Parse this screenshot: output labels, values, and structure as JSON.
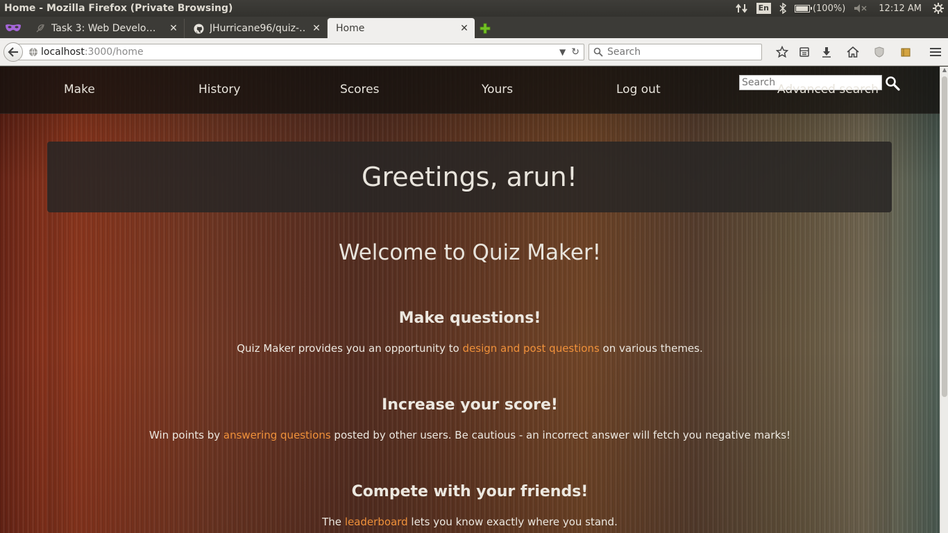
{
  "os_panel": {
    "window_title": "Home - Mozilla Firefox (Private Browsing)",
    "keyboard_layout": "En",
    "battery": "(100%)",
    "battery_level": 1.0,
    "time": "12:12 AM"
  },
  "tabs": [
    {
      "label": "Task 3: Web Develo…",
      "icon": "quill-icon",
      "active": false
    },
    {
      "label": "JHurricane96/quiz-…",
      "icon": "github-icon",
      "active": false
    },
    {
      "label": "Home",
      "icon": "",
      "active": true
    }
  ],
  "urlbar": {
    "host": "localhost",
    "path": ":3000/home"
  },
  "browser_search": {
    "placeholder": "Search"
  },
  "site": {
    "nav": {
      "make": "Make",
      "history": "History",
      "scores": "Scores",
      "yours": "Yours",
      "logout": "Log out"
    },
    "search_placeholder": "Search",
    "advanced_search": "Advanced search",
    "greeting": "Greetings, arun!",
    "welcome": "Welcome to Quiz Maker!",
    "features": [
      {
        "heading": "Make questions!",
        "before": "Quiz Maker provides you an opportunity to ",
        "link": "design and post questions",
        "after": " on various themes."
      },
      {
        "heading": "Increase your score!",
        "before": "Win points by ",
        "link": "answering questions",
        "after": " posted by other users. Be cautious - an incorrect answer will fetch you negative marks!"
      },
      {
        "heading": "Compete with your friends!",
        "before": "The ",
        "link": "leaderboard",
        "after": " lets you know exactly where you stand."
      }
    ],
    "link_color": "#f0913a"
  }
}
